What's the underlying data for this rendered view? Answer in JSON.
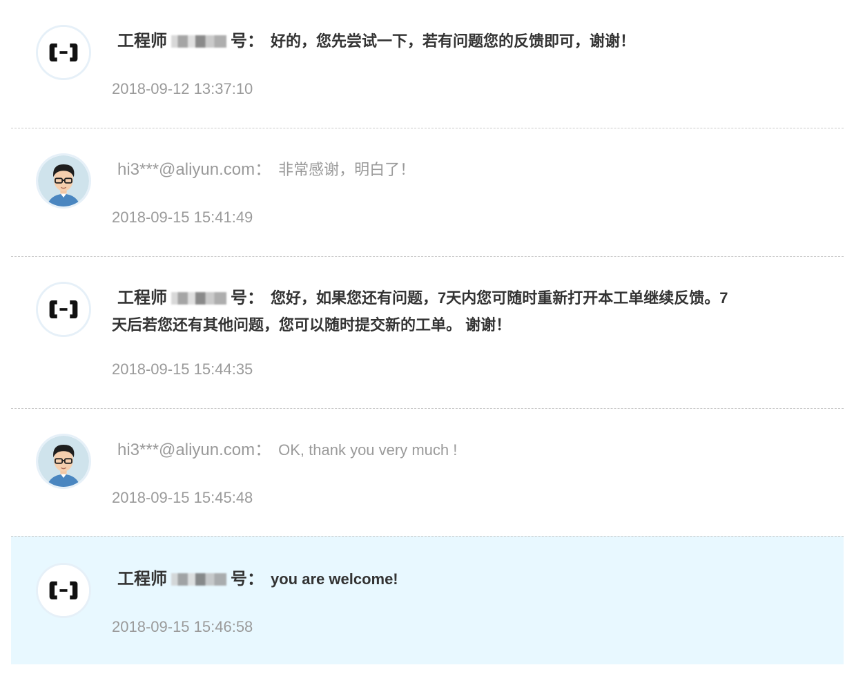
{
  "messages": [
    {
      "author": "工程师",
      "author_suffix": "号：",
      "text": "好的，您先尝试一下，若有问题您的反馈即可，谢谢！",
      "time": "2018-09-12 13:37:10",
      "avatar": "aliyun-logo-icon"
    },
    {
      "author": "hi3***@aliyun.com：",
      "text": "非常感谢，明白了！",
      "time": "2018-09-15 15:41:49",
      "avatar": "user-avatar"
    },
    {
      "author": "工程师",
      "author_suffix": "号：",
      "text": "您好，如果您还有问题，7天内您可随时重新打开本工单继续反馈。7天后若您还有其他问题，您可以随时提交新的工单。 谢谢！",
      "time": "2018-09-15 15:44:35",
      "avatar": "aliyun-logo-icon"
    },
    {
      "author": "hi3***@aliyun.com：",
      "text": "OK, thank you very much !",
      "time": "2018-09-15 15:45:48",
      "avatar": "user-avatar"
    },
    {
      "author": "工程师",
      "author_suffix": "号：",
      "text": "you are welcome!",
      "time": "2018-09-15 15:46:58",
      "avatar": "aliyun-logo-icon"
    }
  ],
  "colors": {
    "highlight_bg": "#e8f8ff",
    "separator": "#c8c8c8",
    "engineer_text": "#333333",
    "user_text": "#9a9a9a"
  }
}
